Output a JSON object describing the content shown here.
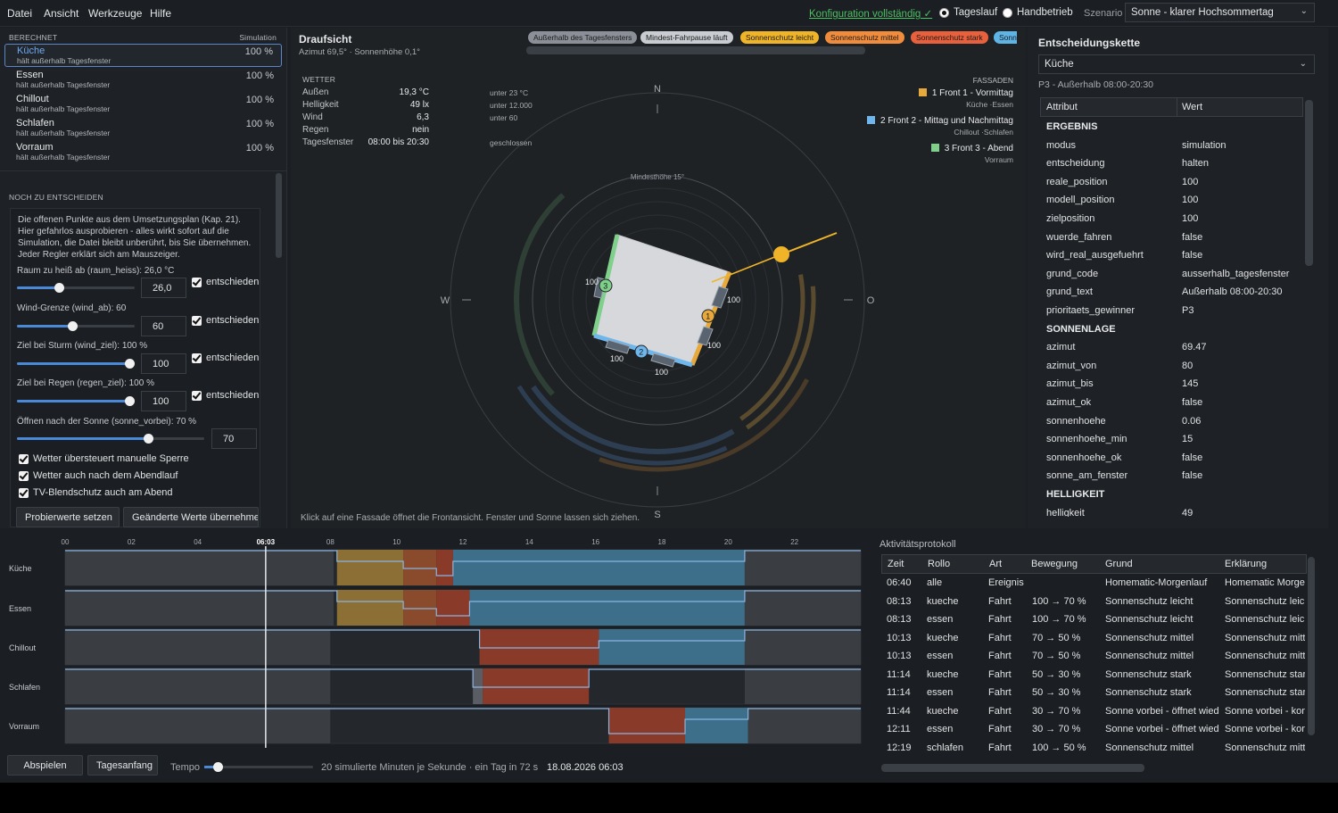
{
  "menu": {
    "items": [
      "Datei",
      "Ansicht",
      "Werkzeuge",
      "Hilfe"
    ]
  },
  "topbar": {
    "config_status": "Konfiguration vollständig ✓",
    "mode_options": [
      "Tageslauf",
      "Handbetrieb"
    ],
    "mode_selected": "Tageslauf",
    "scenario_label": "Szenario",
    "scenario_value": "Sonne - klarer Hochsommertag"
  },
  "rooms_panel": {
    "header_left": "BERECHNET",
    "header_right": "Simulation",
    "rooms": [
      {
        "name": "Küche",
        "status": "hält   außerhalb Tagesfenster",
        "value": "100 %",
        "selected": true
      },
      {
        "name": "Essen",
        "status": "hält   außerhalb Tagesfenster",
        "value": "100 %"
      },
      {
        "name": "Chillout",
        "status": "hält   außerhalb Tagesfenster",
        "value": "100 %"
      },
      {
        "name": "Schlafen",
        "status": "hält   außerhalb Tagesfenster",
        "value": "100 %"
      },
      {
        "name": "Vorraum",
        "status": "hält   außerhalb Tagesfenster",
        "value": "100 %"
      }
    ]
  },
  "open_points": {
    "header": "NOCH ZU ENTSCHEIDEN",
    "description": "Die offenen Punkte aus dem Umsetzungsplan (Kap. 21). Hier gefahrlos ausprobieren - alles wirkt sofort auf die Simulation, die Datei bleibt unberührt, bis Sie übernehmen. Jeder Regler erklärt sich am Mauszeiger.",
    "sliders": [
      {
        "label": "Raum zu heiß ab (raum_heiss):  26,0 °C",
        "value": "26,0",
        "level": 0.35,
        "checked_label": "entschieden"
      },
      {
        "label": "Wind-Grenze (wind_ab):  60",
        "value": "60",
        "level": 0.47,
        "checked_label": "entschieden"
      },
      {
        "label": "Ziel bei Sturm (wind_ziel):  100 %",
        "value": "100",
        "level": 1.0,
        "checked_label": "entschieden"
      },
      {
        "label": "Ziel bei Regen (regen_ziel):  100 %",
        "value": "100",
        "level": 1.0,
        "checked_label": "entschieden"
      },
      {
        "label": "Öffnen nach der Sonne (sonne_vorbei):  70 %",
        "value": "70",
        "level": 0.7
      }
    ],
    "checkboxes": [
      "Wetter übersteuert manuelle Sperre",
      "Wetter auch nach dem Abendlauf",
      "TV-Blendschutz auch am Abend"
    ],
    "buttons": [
      "Probierwerte setzen",
      "Geänderte Werte übernehmen"
    ]
  },
  "view": {
    "title": "Draufsicht",
    "subtitle": "Azimut 69,5°  ·  Sonnenhöhe 0,1°",
    "badges": [
      {
        "label": "Außerhalb des Tagesfensters",
        "color": "#8b9098"
      },
      {
        "label": "Mindest-Fahrpause läuft",
        "color": "#c9ccd0"
      },
      {
        "label": "Sonnenschutz leicht",
        "color": "#f0b429"
      },
      {
        "label": "Sonnenschutz mittel",
        "color": "#f08c3c"
      },
      {
        "label": "Sonnenschutz stark",
        "color": "#e8603c"
      },
      {
        "label": "Sonn",
        "color": "#5fb4e6"
      }
    ],
    "weather_header": "WETTER",
    "weather": [
      {
        "key": "Außen",
        "value": "19,3 °C",
        "threshold": "unter 23 °C"
      },
      {
        "key": "Helligkeit",
        "value": "49 lx",
        "threshold": "unter 12.000"
      },
      {
        "key": "Wind",
        "value": "6,3",
        "threshold": "unter 60"
      },
      {
        "key": "Regen",
        "value": "nein",
        "threshold": ""
      },
      {
        "key": "Tagesfenster",
        "value": "08:00 bis 20:30",
        "threshold": "geschlossen"
      }
    ],
    "facades_header": "FASSADEN",
    "facades": [
      {
        "label": "1   Front 1 - Vormittag",
        "rooms": "Küche ·Essen",
        "color": "#e8a93c"
      },
      {
        "label": "2   Front 2 - Mittag und Nachmittag",
        "rooms": "Chillout ·Schlafen",
        "color": "#6fb6ec"
      },
      {
        "label": "3   Front 3 - Abend",
        "rooms": "Vorraum",
        "color": "#7ed08a"
      }
    ],
    "compass": {
      "n": "N",
      "s": "S",
      "w": "W",
      "o": "O"
    },
    "min_height_label": "Mindesthöhe 15°",
    "window_values": [
      "100",
      "100",
      "100",
      "100",
      "100"
    ],
    "markers": [
      "1",
      "2",
      "3"
    ],
    "hint": "Klick auf eine Fassade öffnet die Frontansicht. Fenster und Sonne lassen sich ziehen."
  },
  "decision": {
    "title": "Entscheidungskette",
    "room_select": "Küche",
    "subtitle": "P3 - Außerhalb 08:00-20:30",
    "columns": [
      "Attribut",
      "Wert"
    ],
    "rows": [
      {
        "k": "ERGEBNIS",
        "v": "",
        "section": true
      },
      {
        "k": "modus",
        "v": "simulation"
      },
      {
        "k": "entscheidung",
        "v": "halten"
      },
      {
        "k": "reale_position",
        "v": "100"
      },
      {
        "k": "modell_position",
        "v": "100"
      },
      {
        "k": "zielposition",
        "v": "100"
      },
      {
        "k": "wuerde_fahren",
        "v": "false"
      },
      {
        "k": "wird_real_ausgefuehrt",
        "v": "false"
      },
      {
        "k": "grund_code",
        "v": "ausserhalb_tagesfenster"
      },
      {
        "k": "grund_text",
        "v": "Außerhalb 08:00-20:30"
      },
      {
        "k": "prioritaets_gewinner",
        "v": "P3"
      },
      {
        "k": "SONNENLAGE",
        "v": "",
        "section": true
      },
      {
        "k": "azimut",
        "v": "69.47"
      },
      {
        "k": "azimut_von",
        "v": "80"
      },
      {
        "k": "azimut_bis",
        "v": "145"
      },
      {
        "k": "azimut_ok",
        "v": "false"
      },
      {
        "k": "sonnenhoehe",
        "v": "0.06"
      },
      {
        "k": "sonnenhoehe_min",
        "v": "15"
      },
      {
        "k": "sonnenhoehe_ok",
        "v": "false"
      },
      {
        "k": "sonne_am_fenster",
        "v": "false"
      },
      {
        "k": "HELLIGKEIT",
        "v": "",
        "section": true
      },
      {
        "k": "helligkeit",
        "v": "49"
      }
    ]
  },
  "timeline": {
    "hours": [
      "00",
      "02",
      "04",
      "06:03",
      "08",
      "10",
      "12",
      "14",
      "16",
      "18",
      "20",
      "22"
    ],
    "current_time": 6.05,
    "rooms": [
      "Küche",
      "Essen",
      "Chillout",
      "Schlafen",
      "Vorraum"
    ],
    "buttons": {
      "play": "Abspielen",
      "reset": "Tagesanfang"
    },
    "tempo_label": "Tempo",
    "tempo_text": "20 simulierte Minuten je Sekunde  ·  ein Tag in 72 s",
    "date": "18.08.2026   06:03",
    "colors": {
      "leicht": "#8c6f34",
      "mittel": "#8a4a2c",
      "stark": "#8a3a28",
      "sonne": "#3d6f8a",
      "nacht": "#3a3d42"
    }
  },
  "log": {
    "title": "Aktivitätsprotokoll",
    "columns": [
      "Zeit",
      "Rollo",
      "Art",
      "Bewegung",
      "Grund",
      "Erklärung"
    ],
    "rows": [
      [
        "06:40",
        "alle",
        "Ereignis",
        "",
        "Homematic-Morgenlauf",
        "Homematic Morge"
      ],
      [
        "08:13",
        "kueche",
        "Fahrt",
        "100 → 70 %",
        "Sonnenschutz leicht",
        "Sonnenschutz leich"
      ],
      [
        "08:13",
        "essen",
        "Fahrt",
        "100 → 70 %",
        "Sonnenschutz leicht",
        "Sonnenschutz leich"
      ],
      [
        "10:13",
        "kueche",
        "Fahrt",
        "70 → 50 %",
        "Sonnenschutz mittel",
        "Sonnenschutz mitte"
      ],
      [
        "10:13",
        "essen",
        "Fahrt",
        "70 → 50 %",
        "Sonnenschutz mittel",
        "Sonnenschutz mitte"
      ],
      [
        "11:14",
        "kueche",
        "Fahrt",
        "50 → 30 %",
        "Sonnenschutz stark",
        "Sonnenschutz stark"
      ],
      [
        "11:14",
        "essen",
        "Fahrt",
        "50 → 30 %",
        "Sonnenschutz stark",
        "Sonnenschutz stark"
      ],
      [
        "11:44",
        "kueche",
        "Fahrt",
        "30 → 70 %",
        "Sonne vorbei - öffnet wied",
        "Sonne vorbei - kon"
      ],
      [
        "12:11",
        "essen",
        "Fahrt",
        "30 → 70 %",
        "Sonne vorbei - öffnet wied",
        "Sonne vorbei - kon"
      ],
      [
        "12:19",
        "schlafen",
        "Fahrt",
        "100 → 50 %",
        "Sonnenschutz mittel",
        "Sonnenschutz mitte"
      ]
    ]
  }
}
